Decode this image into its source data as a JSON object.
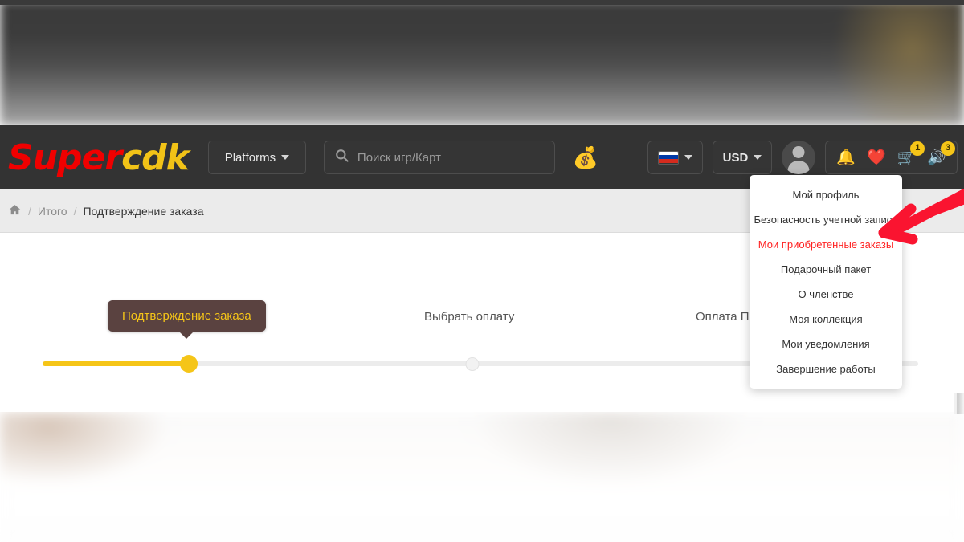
{
  "brand": {
    "logo_part_a": "Super",
    "logo_part_b": "cdk",
    "accent_yellow": "#f5c518",
    "accent_red": "#f00000",
    "header_bg": "#333333",
    "highlight_red": "#ff2020"
  },
  "header": {
    "platforms_label": "Platforms",
    "search_placeholder": "Поиск игр/Карт",
    "search_value": "",
    "money_bag_icon": "money-bag-icon",
    "language_label": "",
    "currency_label": "USD",
    "cart_badge": "1",
    "speaker_badge": "3",
    "icons": {
      "search": "search-icon",
      "bell": "bell-icon",
      "heart": "heart-icon",
      "cart": "cart-icon",
      "speaker": "speaker-icon",
      "avatar": "avatar-icon"
    }
  },
  "breadcrumb": {
    "home_icon": "home-icon",
    "separator": "/",
    "items": [
      {
        "label": "Итого",
        "current": false
      },
      {
        "label": "Подтверждение заказа",
        "current": true
      }
    ]
  },
  "checkout": {
    "steps": [
      {
        "label": "Подтверждение заказа",
        "state": "active"
      },
      {
        "label": "Выбрать оплату",
        "state": "pending"
      },
      {
        "label": "Оплата П",
        "state": "pending"
      }
    ],
    "progress_percent": 17
  },
  "account_menu": {
    "items": [
      {
        "label": "Мой профиль",
        "highlighted": false
      },
      {
        "label": "Безопасность учетной записи",
        "highlighted": false
      },
      {
        "label": "Мои приобретенные заказы",
        "highlighted": true
      },
      {
        "label": "Подарочный пакет",
        "highlighted": false
      },
      {
        "label": "О членстве",
        "highlighted": false
      },
      {
        "label": "Моя коллекция",
        "highlighted": false
      },
      {
        "label": "Мои уведомления",
        "highlighted": false
      },
      {
        "label": "Завершение работы",
        "highlighted": false
      }
    ]
  },
  "annotation": {
    "arrow_color": "#fa1430",
    "points_to": "Мои приобретенные заказы"
  }
}
